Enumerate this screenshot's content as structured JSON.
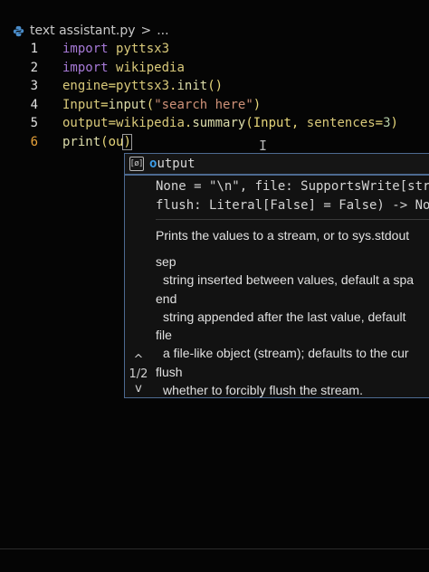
{
  "breadcrumb": {
    "filename": "text assistant.py",
    "separator": ">",
    "ellipsis": "..."
  },
  "lines": [
    {
      "n": "1",
      "parts": [
        [
          "kw",
          "import"
        ],
        [
          "punc",
          " "
        ],
        [
          "var",
          "pyttsx3"
        ]
      ]
    },
    {
      "n": "2",
      "parts": [
        [
          "kw",
          "import"
        ],
        [
          "punc",
          " "
        ],
        [
          "var",
          "wikipedia"
        ]
      ]
    },
    {
      "n": "3",
      "parts": [
        [
          "var",
          "engine"
        ],
        [
          "punc",
          "="
        ],
        [
          "var",
          "pyttsx3"
        ],
        [
          "punc",
          "."
        ],
        [
          "fn",
          "init"
        ],
        [
          "punc",
          "()"
        ]
      ]
    },
    {
      "n": "4",
      "parts": [
        [
          "var",
          "Input"
        ],
        [
          "punc",
          "="
        ],
        [
          "fn",
          "input"
        ],
        [
          "punc",
          "("
        ],
        [
          "str",
          "\"search here\""
        ],
        [
          "punc",
          ")"
        ]
      ]
    },
    {
      "n": "5",
      "parts": [
        [
          "var",
          "output"
        ],
        [
          "punc",
          "="
        ],
        [
          "var",
          "wikipedia"
        ],
        [
          "punc",
          "."
        ],
        [
          "fn",
          "summary"
        ],
        [
          "punc",
          "(Input, "
        ],
        [
          "var",
          "sentences"
        ],
        [
          "punc",
          "="
        ],
        [
          "num",
          "3"
        ],
        [
          "punc",
          ")"
        ]
      ]
    },
    {
      "n": "6",
      "parts": [
        [
          "fn",
          "print"
        ],
        [
          "punc",
          "(ou"
        ],
        [
          "punc",
          ")"
        ]
      ],
      "current": true
    }
  ],
  "suggestion": {
    "icon": "variable-icon",
    "icon_glyph": "[ø]",
    "match": "o",
    "rest": "utput"
  },
  "signature": {
    "code_line_1": "None = \"\\n\", file: SupportsWrite[str",
    "code_line_2": "flush: Literal[False] = False) -> Non",
    "summary": "Prints the values to a stream, or to sys.stdout",
    "params": [
      {
        "name": "sep",
        "desc": "string inserted between values, default a spa"
      },
      {
        "name": "end",
        "desc": "string appended after the last value, default"
      },
      {
        "name": "file",
        "desc": "a file-like object (stream); defaults to the cur"
      },
      {
        "name": "flush",
        "desc": "whether to forcibly flush the stream."
      }
    ],
    "nav_up": "^",
    "page": "1/2",
    "nav_down": "v"
  },
  "colors": {
    "background": "#050505",
    "keyword": "#a679d6",
    "identifier": "#d9c97a",
    "string": "#ce9178",
    "number": "#b5cea8",
    "current_line_number": "#e8a23a",
    "widget_border": "#4d6a91",
    "match_highlight": "#3d9de8"
  }
}
